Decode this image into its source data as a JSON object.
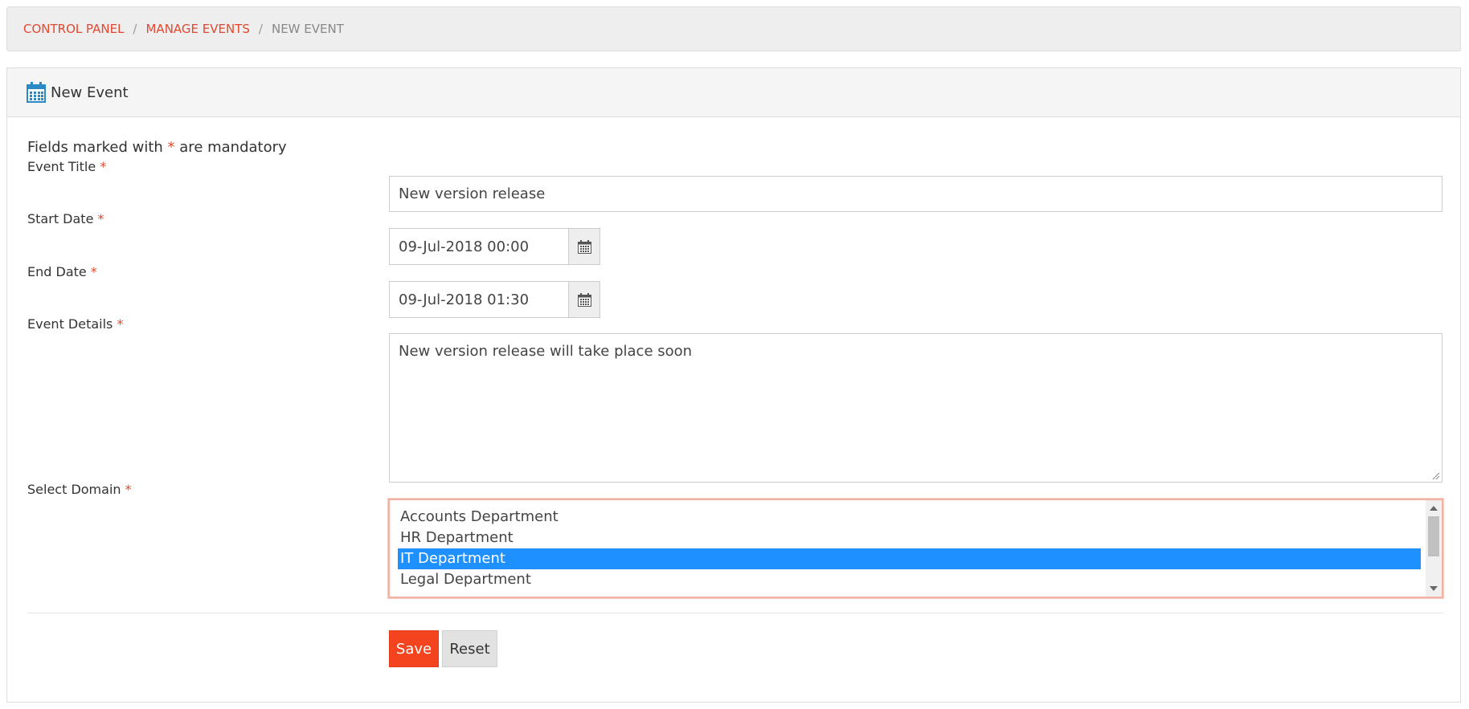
{
  "breadcrumb": {
    "items": [
      "CONTROL PANEL",
      "MANAGE EVENTS"
    ],
    "separator": "/",
    "current": "NEW EVENT"
  },
  "panel": {
    "title": "New Event",
    "icon": "calendar-icon"
  },
  "form": {
    "note_prefix": "Fields marked with",
    "note_asterisk": "*",
    "note_suffix": "are mandatory",
    "required_marker": "*",
    "event_title": {
      "label": "Event Title",
      "value": "New version release"
    },
    "start_date": {
      "label": "Start Date",
      "value": "09-Jul-2018 00:00"
    },
    "end_date": {
      "label": "End Date",
      "value": "09-Jul-2018 01:30"
    },
    "event_details": {
      "label": "Event Details",
      "value": "New version release will take place soon"
    },
    "domain": {
      "label": "Select Domain",
      "options": [
        "Accounts Department",
        "HR Department",
        "IT Department",
        "Legal Department"
      ],
      "selected": "IT Department"
    }
  },
  "buttons": {
    "save": "Save",
    "reset": "Reset"
  },
  "colors": {
    "accent": "#e4472f",
    "selection": "#1e90ff",
    "save_button": "#f4441f"
  }
}
